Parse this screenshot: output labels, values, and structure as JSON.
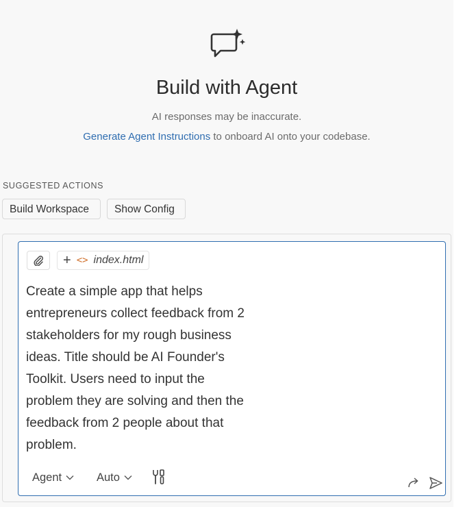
{
  "hero": {
    "icon": "chat-sparkle-icon",
    "title": "Build with Agent",
    "subtitle": "AI responses may be inaccurate.",
    "instructions_link": "Generate Agent Instructions",
    "instructions_rest": " to onboard AI onto your codebase."
  },
  "suggested": {
    "label": "SUGGESTED ACTIONS",
    "actions": [
      "Build Workspace",
      "Show Config"
    ]
  },
  "editor": {
    "attach_icon": "paperclip-icon",
    "file_chip": {
      "plus": "+",
      "code_glyph": "<>",
      "filename": "index.html"
    },
    "prompt": "Create a simple app that helps\nentrepreneurs collect feedback from 2\nstakeholders for my rough business\nideas. Title should be AI Founder's\nToolkit. Users need to input the\nproblem they are solving and then the\nfeedback from 2 people about that\nproblem.",
    "mode": "Agent",
    "model": "Auto",
    "tools_icon": "tools-icon",
    "redo_icon": "redo-arrow-icon",
    "send_icon": "send-icon"
  },
  "colors": {
    "accent": "#2f6db0",
    "background": "#f8f8f8",
    "chip_code": "#d0702b"
  }
}
